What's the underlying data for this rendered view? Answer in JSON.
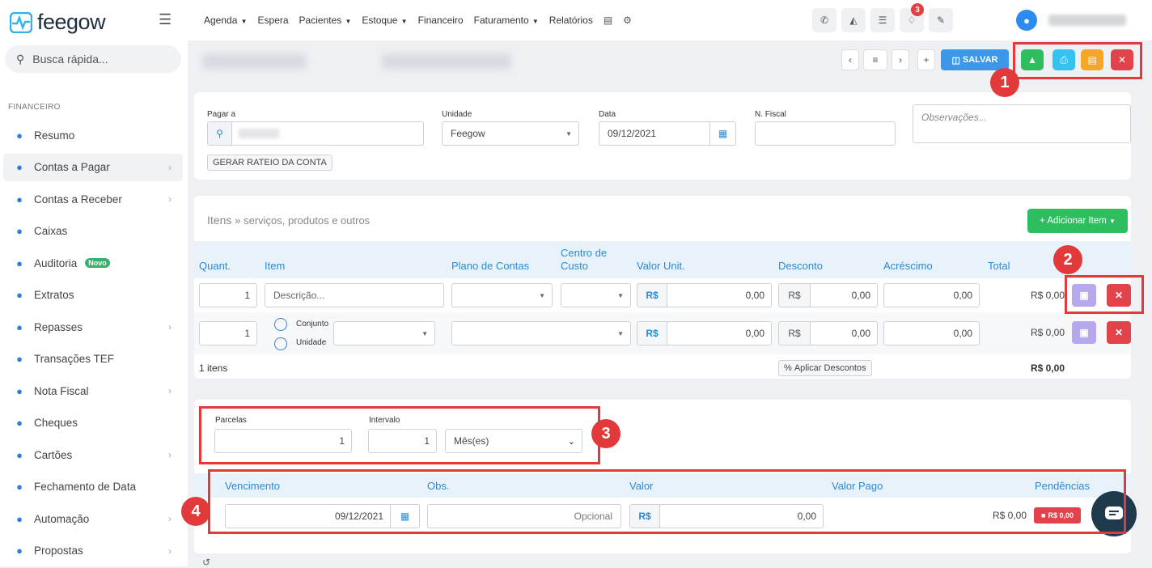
{
  "app": {
    "name": "feegow"
  },
  "search": {
    "placeholder": "Busca rápida..."
  },
  "sidebar": {
    "section": "FINANCEIRO",
    "items": [
      {
        "label": "Resumo",
        "icon": "chart-pie-icon",
        "chev": false,
        "active": false
      },
      {
        "label": "Contas a Pagar",
        "icon": "plus-circle-icon",
        "chev": true,
        "active": true
      },
      {
        "label": "Contas a Receber",
        "icon": "plus-circle-icon",
        "chev": true,
        "active": false
      },
      {
        "label": "Caixas",
        "icon": "inbox-icon",
        "chev": false,
        "active": false
      },
      {
        "label": "Auditoria",
        "icon": "history-icon",
        "chev": false,
        "active": false,
        "badge": "Novo"
      },
      {
        "label": "Extratos",
        "icon": "list-icon",
        "chev": false,
        "active": false
      },
      {
        "label": "Repasses",
        "icon": "handshake-icon",
        "chev": true,
        "active": false
      },
      {
        "label": "Transações TEF",
        "icon": "card-icon",
        "chev": false,
        "active": false
      },
      {
        "label": "Nota Fiscal",
        "icon": "document-icon",
        "chev": true,
        "active": false
      },
      {
        "label": "Cheques",
        "icon": "cheque-icon",
        "chev": false,
        "active": false
      },
      {
        "label": "Cartões",
        "icon": "card-icon",
        "chev": true,
        "active": false
      },
      {
        "label": "Fechamento de Data",
        "icon": "lock-icon",
        "chev": false,
        "active": false
      },
      {
        "label": "Automação",
        "icon": "cogs-icon",
        "chev": true,
        "active": false
      },
      {
        "label": "Propostas",
        "icon": "copy-icon",
        "chev": true,
        "active": false
      }
    ]
  },
  "topnav": {
    "items": [
      {
        "label": "Agenda",
        "caret": true
      },
      {
        "label": "Espera",
        "caret": false
      },
      {
        "label": "Pacientes",
        "caret": true
      },
      {
        "label": "Estoque",
        "caret": true
      },
      {
        "label": "Financeiro",
        "caret": false
      },
      {
        "label": "Faturamento",
        "caret": true
      },
      {
        "label": "Relatórios",
        "caret": false
      }
    ],
    "notifications": "3"
  },
  "toolbar": {
    "save_label": "SALVAR"
  },
  "callouts": [
    "1",
    "2",
    "3",
    "4"
  ],
  "form": {
    "pagar_a_label": "Pagar a",
    "unidade_label": "Unidade",
    "unidade_value": "Feegow",
    "data_label": "Data",
    "data_value": "09/12/2021",
    "nfiscal_label": "N. Fiscal",
    "obs_placeholder": "Observações...",
    "rateio_btn": "GERAR RATEIO DA CONTA"
  },
  "items_section": {
    "title": "Itens",
    "subtitle": "» serviços, produtos e outros",
    "add_btn": "+ Adicionar Item",
    "headers": {
      "quant": "Quant.",
      "item": "Item",
      "plano": "Plano de Contas",
      "centro1": "Centro de",
      "centro2": "Custo",
      "valor_unit": "Valor Unit.",
      "desconto": "Desconto",
      "acrescimo": "Acréscimo",
      "total": "Total"
    },
    "rows": [
      {
        "quant": "1",
        "item_placeholder": "Descrição...",
        "valor": "0,00",
        "desconto": "0,00",
        "acrescimo": "0,00",
        "total": "R$ 0,00"
      },
      {
        "quant": "1",
        "radio1": "Conjunto",
        "radio2": "Unidade",
        "valor": "0,00",
        "desconto": "0,00",
        "acrescimo": "0,00",
        "total": "R$ 0,00"
      }
    ],
    "currency": "R$",
    "count_label": "1 itens",
    "apply_discount": "Aplicar Descontos",
    "footer_total": "R$ 0,00"
  },
  "parcelas": {
    "parcelas_label": "Parcelas",
    "parcelas_value": "1",
    "intervalo_label": "Intervalo",
    "intervalo_value": "1",
    "periodo_value": "Mês(es)"
  },
  "vencimentos": {
    "headers": {
      "vencimento": "Vencimento",
      "obs": "Obs.",
      "valor": "Valor",
      "valor_pago": "Valor Pago",
      "pendencias": "Pendências"
    },
    "row": {
      "date": "09/12/2021",
      "obs_placeholder": "Opcional",
      "currency": "R$",
      "valor": "0,00",
      "valor_pago": "R$ 0,00",
      "pendencia_badge": "R$ 0,00"
    }
  },
  "colors": {
    "accent": "#2b8ad6",
    "green": "#2ebd5f",
    "cyan": "#34c3f0",
    "orange": "#f5a623",
    "red": "#e2424a",
    "purple": "#b7a8ee",
    "callout": "#e23a3a"
  }
}
